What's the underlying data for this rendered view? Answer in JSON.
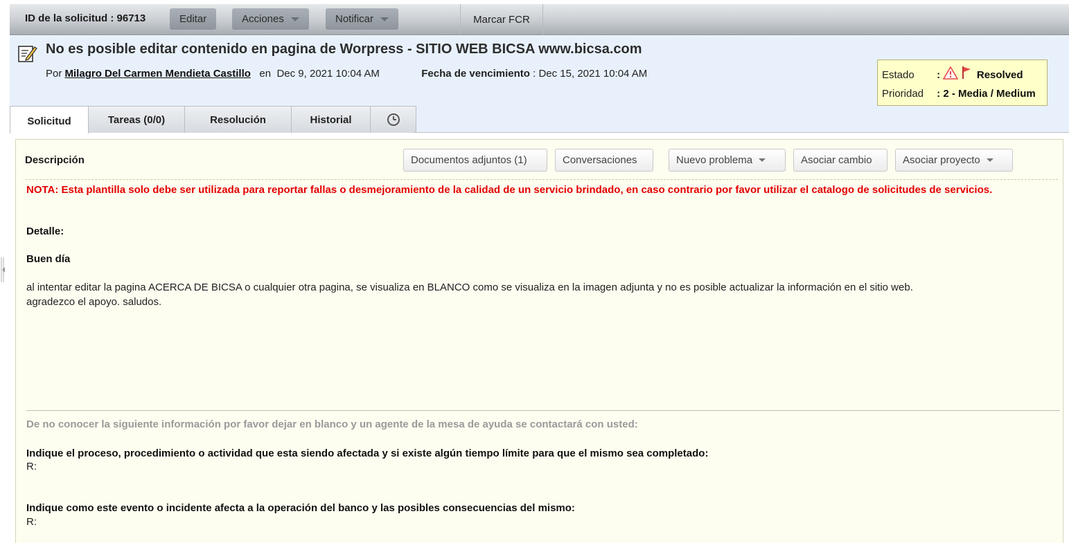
{
  "toolbar": {
    "request_id_label": "ID de la solicitud : 96713",
    "edit_label": "Editar",
    "actions_label": "Acciones",
    "notify_label": "Notificar",
    "fcr_label": "Marcar FCR"
  },
  "header": {
    "title": "No es posible editar contenido en pagina de Worpress - SITIO WEB BICSA www.bicsa.com",
    "by_label": "Por",
    "author": "Milagro Del Carmen Mendieta Castillo",
    "on_label": "en",
    "created": "Dec 9, 2021 10:04 AM",
    "due_label": "Fecha de vencimiento",
    "due_sep": ":",
    "due_date": "Dec 15, 2021 10:04 AM",
    "status_label": "Estado",
    "status_sep": ":",
    "status_value": "Resolved",
    "priority_label": "Prioridad",
    "priority_sep": ":",
    "priority_value": "2 - Media / Medium",
    "status_icons": [
      "warning-icon",
      "flag-icon"
    ],
    "colors": {
      "warning": "#e44a4a",
      "flag": "#e24747"
    }
  },
  "tabs": [
    {
      "label": "Solicitud",
      "active": true
    },
    {
      "label": "Tareas (0/0)",
      "active": false
    },
    {
      "label": "Resolución",
      "active": false
    },
    {
      "label": "Historial",
      "active": false
    },
    {
      "label": "",
      "icon": "clock-icon",
      "active": false
    }
  ],
  "description": {
    "title": "Descripción",
    "buttons": {
      "attachments": "Documentos adjuntos (1)",
      "conversations": "Conversaciones",
      "new_problem": "Nuevo problema",
      "associate_change": "Asociar cambio",
      "associate_project": "Asociar proyecto"
    },
    "note": "NOTA: Esta plantilla solo debe ser utilizada para reportar fallas o desmejoramiento de la calidad  de un servicio brindado, en caso contrario por favor utilizar el catalogo de solicitudes de servicios.",
    "detail_label": "Detalle:",
    "greeting": "Buen día",
    "body_line1": "al intentar editar la pagina ACERCA DE BICSA o cualquier otra pagina, se visualiza en BLANCO como se visualiza en la imagen adjunta y no es posible actualizar la información en el sitio web.",
    "body_line2": "agradezco el apoyo. saludos.",
    "info_note": "De no conocer la siguiente información por favor dejar en blanco y un agente de la mesa de ayuda se contactará con usted:",
    "q1": "Indique el proceso, procedimiento o actividad que esta siendo afectada y si existe algún tiempo límite para que el mismo sea completado:",
    "a1": "R:",
    "q2": "Indique como este evento o incidente afecta a la operación del banco y las posibles consecuencias del mismo:",
    "a2": "R:"
  }
}
